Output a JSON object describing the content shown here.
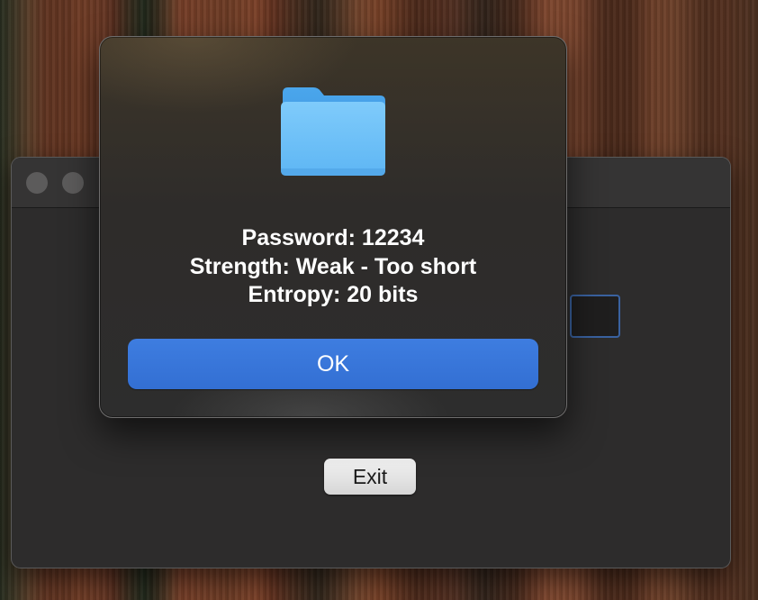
{
  "desktop": {
    "wallpaper": "redwood-forest"
  },
  "main_window": {
    "exit_label": "Exit",
    "traffic_light_color": "#5c5b5b",
    "field_focus_color": "#3a62a0"
  },
  "alert": {
    "icon": "folder-icon",
    "lines": [
      "Password: 12234",
      "Strength: Weak - Too short",
      "Entropy: 20 bits"
    ],
    "ok_label": "OK",
    "ok_color": "#3a77dd"
  }
}
